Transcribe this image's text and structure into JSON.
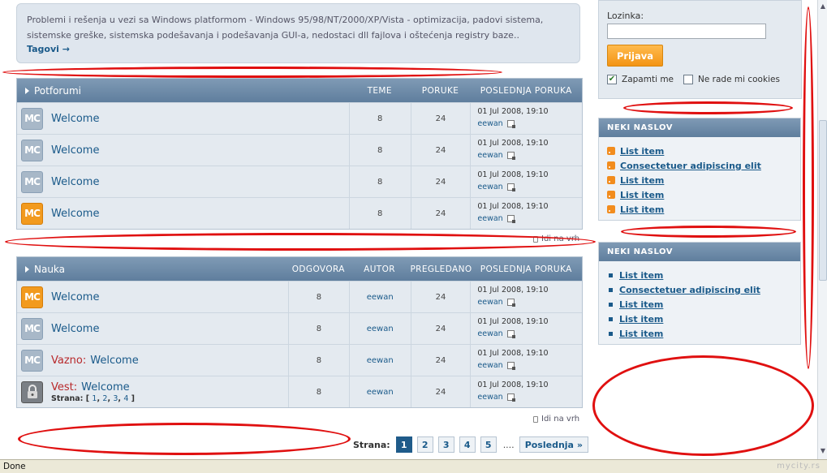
{
  "description": {
    "text": "Problemi i rešenja u vezi sa Windows platformom - Windows 95/98/NT/2000/XP/Vista - optimizacija, padovi sistema, sistemske greške, sistemska podešavanja i podešavanja GUI-a, nedostaci dll fajlova i oštećenja registry baze..",
    "tags_link": "Tagovi →"
  },
  "subforums": {
    "title": "Potforumi",
    "columns": [
      "TEME",
      "PORUKE",
      "POSLEDNJA PORUKA"
    ],
    "rows": [
      {
        "icon": "mc-icon-gray",
        "title": "Welcome",
        "topics": "8",
        "posts": "24",
        "last_date": "01 Jul 2008, 19:10",
        "last_user": "eewan"
      },
      {
        "icon": "mc-icon-gray",
        "title": "Welcome",
        "topics": "8",
        "posts": "24",
        "last_date": "01 Jul 2008, 19:10",
        "last_user": "eewan"
      },
      {
        "icon": "mc-icon-gray",
        "title": "Welcome",
        "topics": "8",
        "posts": "24",
        "last_date": "01 Jul 2008, 19:10",
        "last_user": "eewan"
      },
      {
        "icon": "mc-icon-orange",
        "title": "Welcome",
        "topics": "8",
        "posts": "24",
        "last_date": "01 Jul 2008, 19:10",
        "last_user": "eewan"
      }
    ],
    "top_link": "Idi na vrh"
  },
  "nauka": {
    "title": "Nauka",
    "columns": [
      "ODGOVORA",
      "AUTOR",
      "PREGLEDANO",
      "POSLEDNJA PORUKA"
    ],
    "rows": [
      {
        "icon": "mc-icon-orange",
        "prefix": "",
        "title": "Welcome",
        "replies": "8",
        "author": "eewan",
        "views": "24",
        "last_date": "01 Jul 2008, 19:10",
        "last_user": "eewan"
      },
      {
        "icon": "mc-icon-gray",
        "prefix": "",
        "title": "Welcome",
        "replies": "8",
        "author": "eewan",
        "views": "24",
        "last_date": "01 Jul 2008, 19:10",
        "last_user": "eewan"
      },
      {
        "icon": "mc-icon-gray",
        "prefix": "Vazno:",
        "title": "Welcome",
        "replies": "8",
        "author": "eewan",
        "views": "24",
        "last_date": "01 Jul 2008, 19:10",
        "last_user": "eewan"
      },
      {
        "icon": "lock-icon",
        "prefix": "Vest:",
        "title": "Welcome",
        "replies": "8",
        "author": "eewan",
        "views": "24",
        "last_date": "01 Jul 2008, 19:10",
        "last_user": "eewan"
      }
    ],
    "strana_label": "Strana:",
    "strana_pages": [
      "1",
      "2",
      "3",
      "4"
    ],
    "top_link": "Idi na vrh"
  },
  "pagination": {
    "label": "Strana:",
    "pages": [
      "1",
      "2",
      "3",
      "4",
      "5"
    ],
    "active": "1",
    "ellipsis": "....",
    "last": "Poslednja »"
  },
  "login": {
    "password_label": "Lozinka:",
    "submit": "Prijava",
    "remember": "Zapamti me",
    "no_cookies": "Ne rade mi cookies"
  },
  "widget1": {
    "title": "NEKI NASLOV",
    "items": [
      "List item",
      "Consectetuer adipiscing elit",
      "List item",
      "List item",
      "List item"
    ]
  },
  "widget2": {
    "title": "NEKI NASLOV",
    "items": [
      "List item",
      "Consectetuer adipiscing elit",
      "List item",
      "List item",
      "List item"
    ]
  },
  "status_bar": {
    "text": "Done",
    "watermark": "mycity.rs"
  },
  "colors": {
    "header_blue": "#6f8cab",
    "link": "#1a5a8a",
    "accent_orange": "#f39415",
    "annotation_red": "#e01010"
  }
}
